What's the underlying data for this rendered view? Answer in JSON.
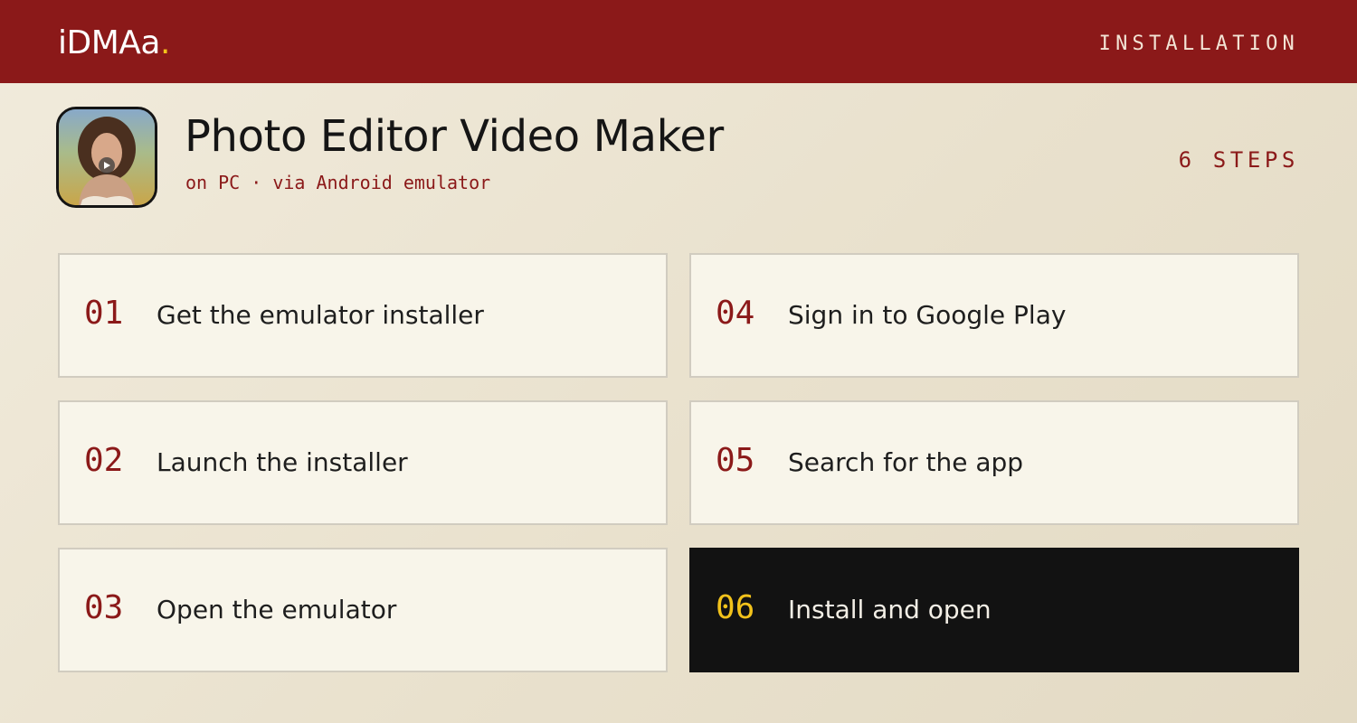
{
  "header": {
    "brand": "iDMAa",
    "brand_dot": ".",
    "section_label": "INSTALLATION"
  },
  "app": {
    "title": "Photo Editor Video Maker",
    "subtitle": "on PC · via Android emulator",
    "icon": "photo-video-app-icon"
  },
  "step_count_label": "6 STEPS",
  "steps": [
    {
      "number": "01",
      "label": "Get the emulator installer"
    },
    {
      "number": "02",
      "label": "Launch the installer"
    },
    {
      "number": "03",
      "label": "Open the emulator"
    },
    {
      "number": "04",
      "label": "Sign in to Google Play"
    },
    {
      "number": "05",
      "label": "Search for the app"
    },
    {
      "number": "06",
      "label": "Install and open"
    }
  ],
  "colors": {
    "header_bg": "#8b1919",
    "accent_yellow": "#f2c21b",
    "card_bg": "#f8f5ea",
    "active_card_bg": "#121212",
    "step_number": "#8b1919"
  }
}
